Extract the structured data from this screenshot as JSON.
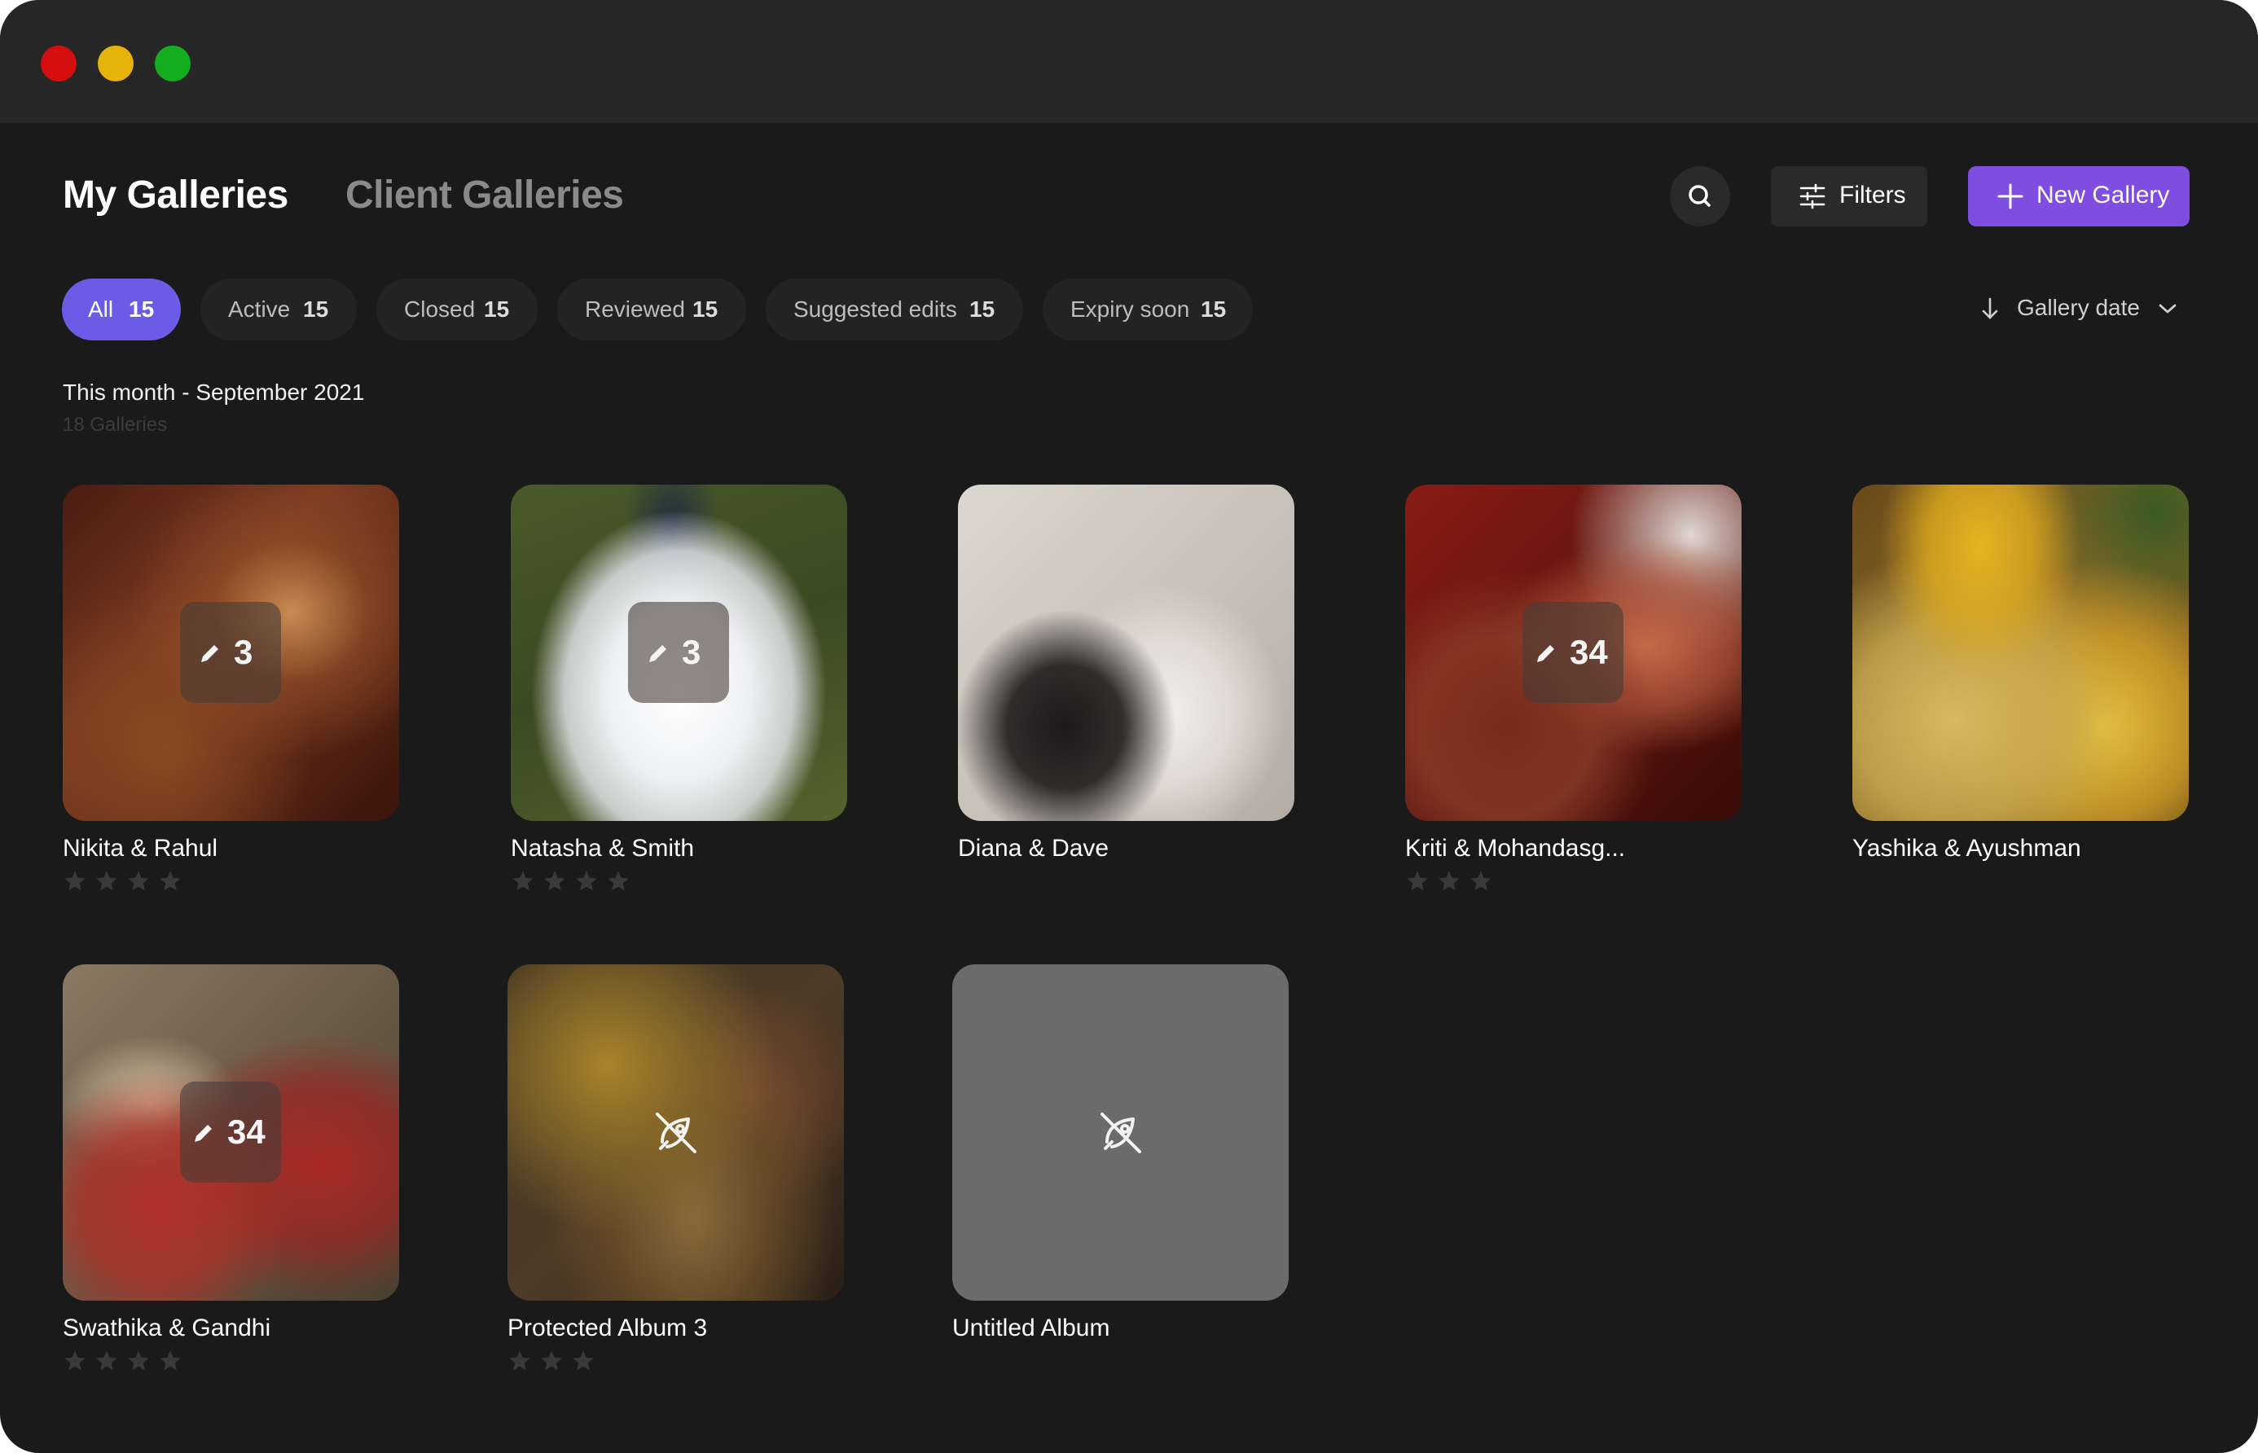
{
  "tabs": {
    "my_galleries": "My Galleries",
    "client_galleries": "Client Galleries"
  },
  "toolbar": {
    "filters_label": "Filters",
    "new_gallery_label": "New Gallery"
  },
  "chips": [
    {
      "label": "All",
      "count": "15",
      "active": true
    },
    {
      "label": "Active",
      "count": "15"
    },
    {
      "label": "Closed",
      "count": "15"
    },
    {
      "label": "Reviewed",
      "count": "15"
    },
    {
      "label": "Suggested edits",
      "count": "15"
    },
    {
      "label": "Expiry soon",
      "count": "15"
    }
  ],
  "sort": {
    "label": "Gallery date"
  },
  "section": {
    "title": "This month - September 2021",
    "subtitle": "18 Galleries"
  },
  "galleries": [
    {
      "title": "Nikita & Rahul",
      "edits": "3",
      "stars": 4
    },
    {
      "title": "Natasha & Smith",
      "edits": "3",
      "stars": 4
    },
    {
      "title": "Diana & Dave",
      "stars": 0
    },
    {
      "title": "Kriti & Mohandasg...",
      "edits": "34",
      "stars": 3
    },
    {
      "title": "Yashika & Ayushman",
      "stars": 0
    },
    {
      "title": "Swathika & Gandhi",
      "edits": "34",
      "stars": 4
    },
    {
      "title": "Protected Album 3",
      "stars": 3,
      "protected": true
    },
    {
      "title": "Untitled Album",
      "stars": 0,
      "protected": true
    }
  ],
  "colors": {
    "accent": "#7f4ee0",
    "chip_active": "#6b5ce7",
    "background": "#1a1a1a",
    "titlebar": "#262626"
  }
}
